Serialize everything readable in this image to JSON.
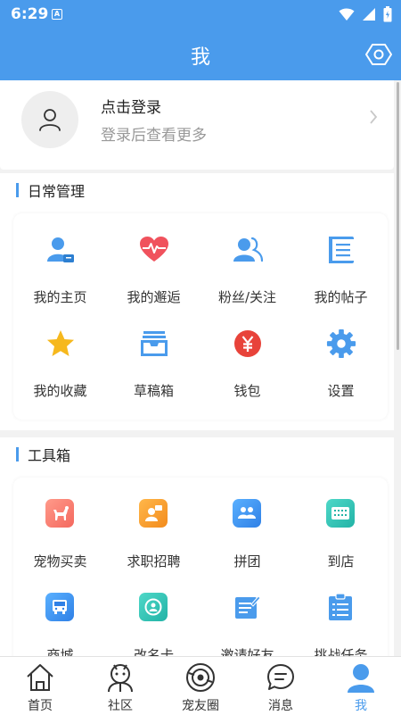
{
  "status_bar": {
    "time": "6:29",
    "notif_letter": "A"
  },
  "header": {
    "title": "我"
  },
  "login": {
    "title": "点击登录",
    "subtitle": "登录后查看更多"
  },
  "daily": {
    "section_title": "日常管理",
    "items": [
      {
        "label": "我的主页",
        "icon": "user-card-icon"
      },
      {
        "label": "我的邂逅",
        "icon": "heart-pulse-icon"
      },
      {
        "label": "粉丝/关注",
        "icon": "fans-icon"
      },
      {
        "label": "我的帖子",
        "icon": "document-list-icon"
      },
      {
        "label": "我的收藏",
        "icon": "star-icon"
      },
      {
        "label": "草稿箱",
        "icon": "inbox-tray-icon"
      },
      {
        "label": "钱包",
        "icon": "yen-coin-icon"
      },
      {
        "label": "设置",
        "icon": "gear-icon"
      }
    ]
  },
  "tools": {
    "section_title": "工具箱",
    "items": [
      {
        "label": "宠物买卖",
        "icon": "dog-icon"
      },
      {
        "label": "求职招聘",
        "icon": "job-icon"
      },
      {
        "label": "拼团",
        "icon": "group-buy-icon"
      },
      {
        "label": "到店",
        "icon": "store-icon"
      },
      {
        "label": "商城",
        "icon": "shop-bus-icon"
      },
      {
        "label": "改名卡",
        "icon": "rename-card-icon"
      },
      {
        "label": "邀请好友",
        "icon": "invite-icon"
      },
      {
        "label": "挑战任务",
        "icon": "clipboard-task-icon"
      }
    ]
  },
  "nav": {
    "items": [
      {
        "label": "首页",
        "icon": "home-icon"
      },
      {
        "label": "社区",
        "icon": "community-icon"
      },
      {
        "label": "宠友圈",
        "icon": "pet-circle-icon"
      },
      {
        "label": "消息",
        "icon": "message-icon"
      },
      {
        "label": "我",
        "icon": "me-icon"
      }
    ],
    "active_index": 4
  },
  "colors": {
    "accent": "#4a9bec",
    "heart": "#f0525d",
    "star": "#f6b81d",
    "wallet": "#e8433a"
  }
}
